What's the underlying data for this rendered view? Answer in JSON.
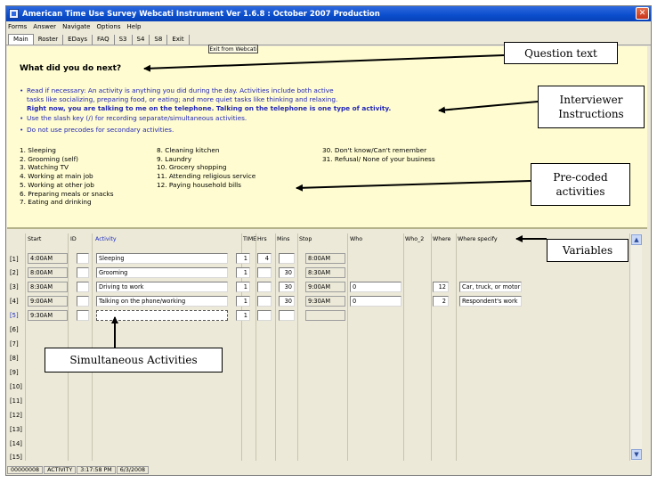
{
  "window": {
    "title": "American Time Use Survey Webcati Instrument Ver 1.6.8 : October 2007 Production",
    "close_glyph": "✕"
  },
  "menu": [
    "Forms",
    "Answer",
    "Navigate",
    "Options",
    "Help"
  ],
  "tabs": [
    "Main",
    "Roster",
    "EDays",
    "FAQ",
    "S3",
    "S4",
    "S8",
    "Exit"
  ],
  "exit_webcati": "Exit from Webcati",
  "question": "What did you do next?",
  "instructions": {
    "i1_a": "Read if necessary: An activity is anything you did during the day. Activities include both active",
    "i1_b": "tasks like socializing, preparing food, or eating; and more quiet tasks like thinking and relaxing.",
    "i1_c": "Right now, you are talking to me on the telephone. Talking on the telephone is one type of activity.",
    "i2": "Use the slash key (/) for recording separate/simultaneous activities.",
    "i3": "Do not use precodes for secondary activities."
  },
  "codes": {
    "col1": [
      "1. Sleeping",
      "2. Grooming (self)",
      "3. Watching TV",
      "4. Working at main job",
      "5. Working at other job",
      "6. Preparing meals or snacks",
      "7. Eating and drinking"
    ],
    "col2": [
      "8. Cleaning kitchen",
      "9. Laundry",
      "10. Grocery shopping",
      "11. Attending religious service",
      "12. Paying household bills"
    ],
    "col3": [
      "30. Don't know/Can't remember",
      "31. Refusal/ None of your business"
    ]
  },
  "grid": {
    "headers": {
      "start": "Start",
      "id": "ID",
      "activity": "Activity",
      "time": "TIME",
      "hrs": "Hrs",
      "mins": "Mins",
      "stop": "Stop",
      "who": "Who",
      "who2": "Who_2",
      "where": "Where",
      "where_specify": "Where specify"
    },
    "row_labels": [
      "[1]",
      "[2]",
      "[3]",
      "[4]",
      "[5]",
      "[6]",
      "[7]",
      "[8]",
      "[9]",
      "[10]",
      "[11]",
      "[12]",
      "[13]",
      "[14]",
      "[15]"
    ],
    "rows": [
      {
        "start": "4:00AM",
        "activity": "Sleeping",
        "time": "1",
        "hrs": "4",
        "mins": "",
        "stop": "8:00AM",
        "who": "",
        "where": "",
        "where_specify": ""
      },
      {
        "start": "8:00AM",
        "activity": "Grooming",
        "time": "1",
        "hrs": "",
        "mins": "30",
        "stop": "8:30AM",
        "who": "",
        "where": "",
        "where_specify": ""
      },
      {
        "start": "8:30AM",
        "activity": "Driving to work",
        "time": "1",
        "hrs": "",
        "mins": "30",
        "stop": "9:00AM",
        "who": "0",
        "where": "12",
        "where_specify": "Car, truck, or motor"
      },
      {
        "start": "9:00AM",
        "activity": "Talking on the phone/working",
        "time": "1",
        "hrs": "",
        "mins": "30",
        "stop": "9:30AM",
        "who": "0",
        "where": "2",
        "where_specify": "Respondent's work"
      },
      {
        "start": "9:30AM",
        "activity": "",
        "time": "1",
        "hrs": "",
        "mins": "",
        "stop": "",
        "who": "",
        "where": "",
        "where_specify": ""
      }
    ]
  },
  "status": [
    "00000008",
    "ACTIVITY",
    "3:17:58 PM",
    "6/3/2008"
  ],
  "callouts": {
    "question_text": "Question text",
    "interviewer_1": "Interviewer",
    "interviewer_2": "Instructions",
    "precoded_1": "Pre-coded",
    "precoded_2": "activities",
    "variables": "Variables",
    "simultaneous": "Simultaneous Activities"
  },
  "colors": {
    "title_bar": "#0a4dcc",
    "question_panel": "#fefcd0",
    "instruction_text": "#2326b8",
    "grid_background": "#ece9d8"
  }
}
